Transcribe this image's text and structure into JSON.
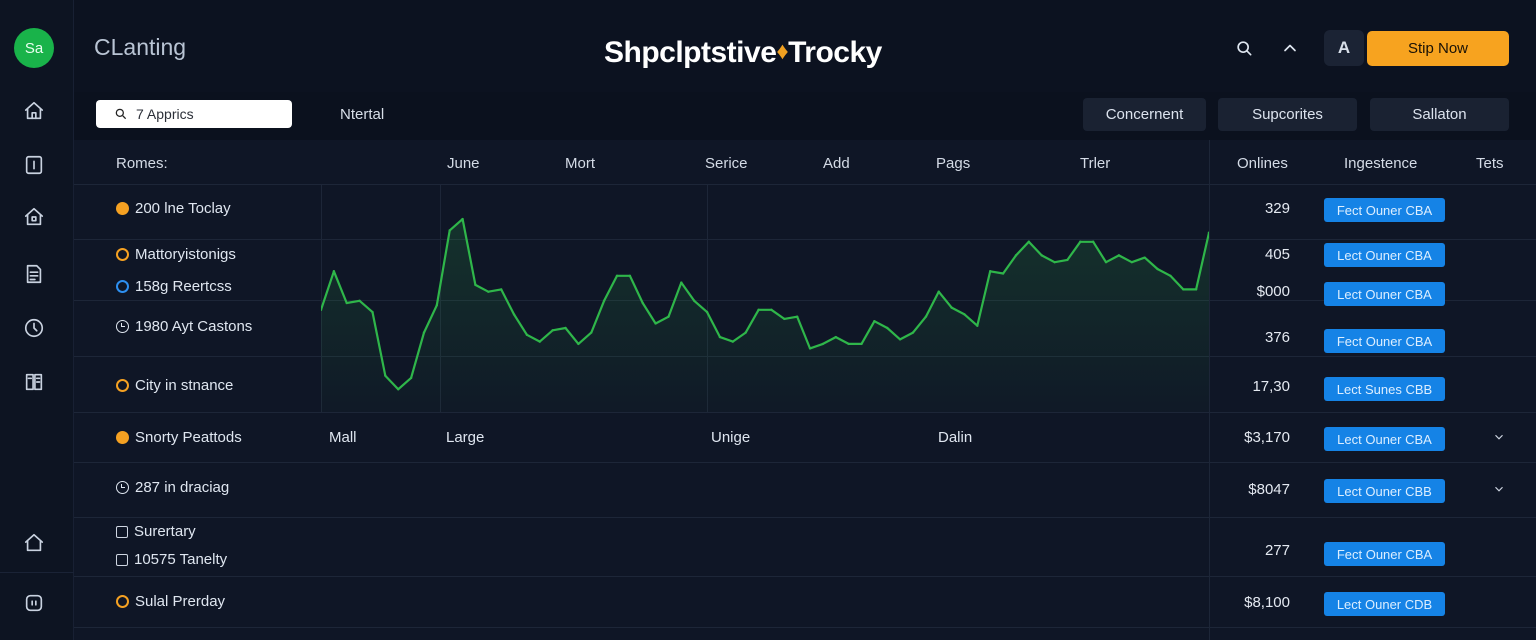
{
  "sidebar": {
    "avatar": "Sa",
    "icons": [
      "home-icon",
      "tablet-icon",
      "home-lock-icon",
      "document-icon",
      "clock-icon",
      "book-icon",
      "home-bottom-icon",
      "chat-icon"
    ]
  },
  "header": {
    "app_name": "CLanting",
    "title_left": "Shpclptstive",
    "title_symbol": "♦",
    "title_right": "Trocky",
    "font_button": "A",
    "cta": "Stip Now"
  },
  "toolbar": {
    "search_placeholder": "7 Apprics",
    "label": "Ntertal",
    "pills": [
      "Concernent",
      "Supcorites",
      "Sallaton"
    ]
  },
  "table": {
    "headers": [
      "Romes:",
      "June",
      "Mort",
      "Serice",
      "Add",
      "Pags",
      "Trler",
      "Onlines",
      "Ingestence",
      "Tets"
    ],
    "rows": [
      {
        "label": "200 lne Toclay",
        "value": "329",
        "tag": "Fect Ouner CBA"
      },
      {
        "label": "Mattoryistonigs",
        "value": "405",
        "tag": "Lect Ouner CBA"
      },
      {
        "label": "158g Reertcss",
        "value": "$000",
        "tag": "Lect Ouner CBA"
      },
      {
        "label": "1980 Ayt Castons",
        "value": "376",
        "tag": "Fect Ouner CBA"
      },
      {
        "label": "City in stnance",
        "value": "17,30",
        "tag": "Lect Sunes CBB"
      },
      {
        "label": "Snorty Peattods",
        "value": "$3,170",
        "tag": "Lect Ouner CBA",
        "cells": [
          "Mall",
          "Large",
          "Unige",
          "Dalin"
        ]
      },
      {
        "label": "287 in draciag",
        "value": "$8047",
        "tag": "Lect Ouner CBB"
      },
      {
        "label": "Surertary",
        "value": "",
        "tag": ""
      },
      {
        "label": "10575 Tanelty",
        "value": "277",
        "tag": "Fect Ouner CBA"
      },
      {
        "label": "Sulal Prerday",
        "value": "$8,100",
        "tag": "Lect Ouner CDB"
      }
    ]
  },
  "colors": {
    "accent_orange": "#f7a31f",
    "tag_blue": "#1583e6",
    "line_green": "#2fb64a",
    "avatar_green": "#19b34a"
  },
  "chart_data": {
    "type": "line",
    "x": [
      0,
      1,
      2,
      3,
      4,
      5,
      6,
      7,
      8,
      9,
      10,
      11,
      12,
      13,
      14,
      15,
      16,
      17,
      18,
      19,
      20,
      21,
      22,
      23,
      24,
      25,
      26,
      27,
      28,
      29,
      30,
      31,
      32,
      33,
      34,
      35,
      36,
      37,
      38,
      39,
      40,
      41,
      42,
      43,
      44,
      45,
      46,
      47,
      48,
      49,
      50,
      51,
      52,
      53,
      54,
      55,
      56,
      57,
      58,
      59,
      60,
      61,
      62,
      63,
      64,
      65,
      66,
      67,
      68,
      69
    ],
    "y": [
      45,
      62,
      48,
      49,
      44,
      16,
      10,
      15,
      35,
      47,
      80,
      85,
      56,
      53,
      54,
      43,
      34,
      31,
      36,
      37,
      30,
      35,
      49,
      60,
      60,
      48,
      39,
      42,
      57,
      49,
      44,
      33,
      31,
      35,
      45,
      45,
      41,
      42,
      28,
      30,
      33,
      30,
      30,
      40,
      37,
      32,
      35,
      42,
      53,
      46,
      43,
      38,
      62,
      61,
      69,
      75,
      69,
      66,
      67,
      75,
      75,
      66,
      69,
      66,
      68,
      63,
      60,
      54,
      54,
      79
    ],
    "grid": true,
    "color": "#2fb64a"
  }
}
